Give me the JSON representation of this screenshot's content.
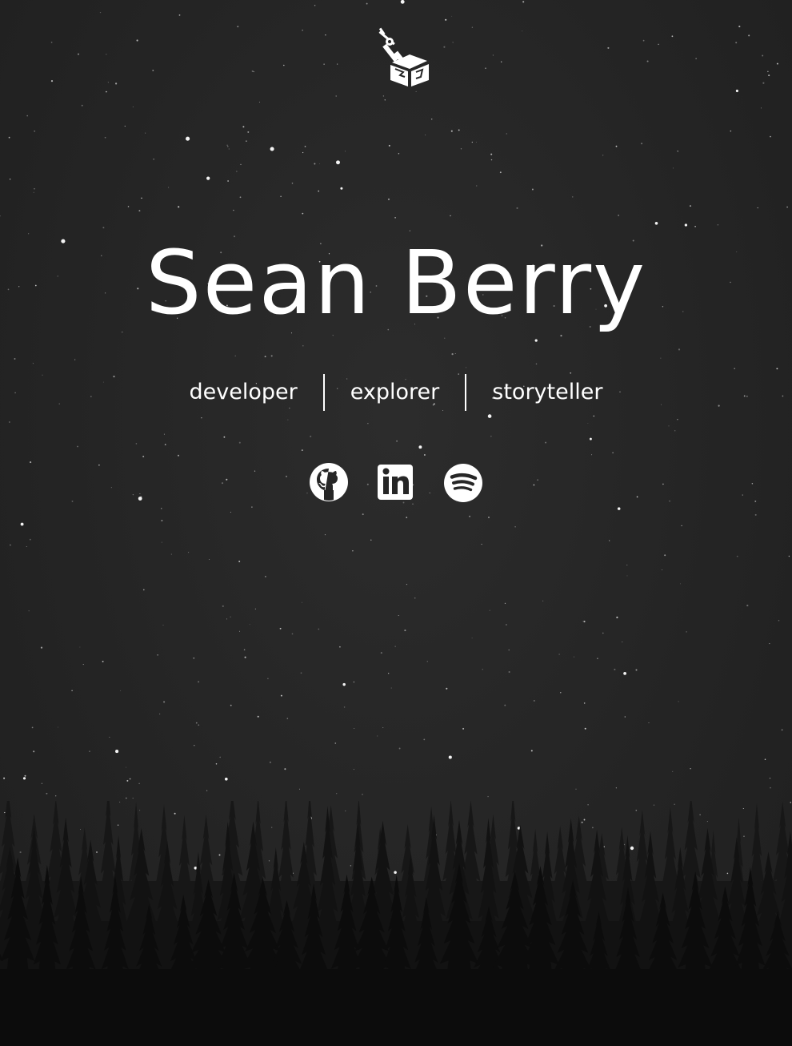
{
  "header": {
    "logo_icon": "sword-in-cube-logo-icon"
  },
  "hero": {
    "name": "Sean Berry",
    "roles": [
      "developer",
      "explorer",
      "storyteller"
    ]
  },
  "socials": [
    {
      "label": "GitHub",
      "icon": "github-icon"
    },
    {
      "label": "LinkedIn",
      "icon": "linkedin-icon"
    },
    {
      "label": "Spotify",
      "icon": "spotify-icon"
    }
  ],
  "colors": {
    "background": "#262626",
    "text": "#ffffff",
    "forest": "#0e0e0e"
  }
}
